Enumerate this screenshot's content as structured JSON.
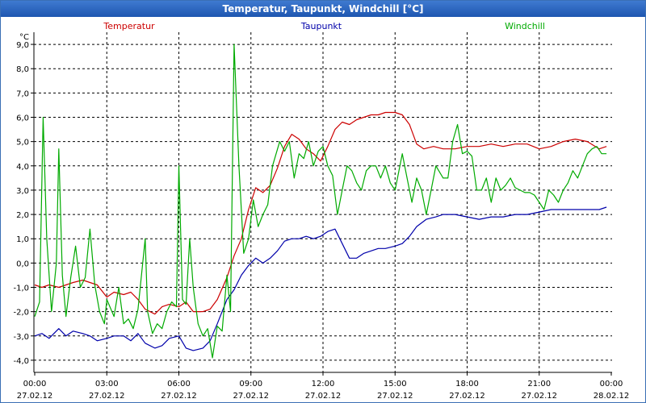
{
  "window": {
    "title": "Temperatur, Taupunkt, Windchill [°C]"
  },
  "chart_data": {
    "type": "line",
    "title": "Temperatur, Taupunkt, Windchill [°C]",
    "ylabel": "°C",
    "ylim": [
      -4.5,
      9.5
    ],
    "xlim": [
      0,
      24
    ],
    "grid": true,
    "legend_position": "top",
    "yticks": [
      "9,0",
      "8,0",
      "7,0",
      "6,0",
      "5,0",
      "4,0",
      "3,0",
      "2,0",
      "1,0",
      "0,0",
      "-1,0",
      "-2,0",
      "-3,0",
      "-4,0"
    ],
    "xticks": [
      {
        "time": "00:00",
        "date": "27.02.12"
      },
      {
        "time": "03:00",
        "date": "27.02.12"
      },
      {
        "time": "06:00",
        "date": "27.02.12"
      },
      {
        "time": "09:00",
        "date": "27.02.12"
      },
      {
        "time": "12:00",
        "date": "27.02.12"
      },
      {
        "time": "15:00",
        "date": "27.02.12"
      },
      {
        "time": "18:00",
        "date": "27.02.12"
      },
      {
        "time": "21:00",
        "date": "27.02.12"
      },
      {
        "time": "00:00",
        "date": "28.02.12"
      }
    ],
    "series": [
      {
        "name": "Temperatur",
        "color": "#cc0000",
        "points": [
          [
            0,
            -0.9
          ],
          [
            0.3,
            -1.0
          ],
          [
            0.6,
            -0.9
          ],
          [
            1.0,
            -1.0
          ],
          [
            1.3,
            -0.9
          ],
          [
            1.6,
            -0.8
          ],
          [
            2.0,
            -0.7
          ],
          [
            2.3,
            -0.8
          ],
          [
            2.6,
            -0.9
          ],
          [
            3.0,
            -1.4
          ],
          [
            3.3,
            -1.2
          ],
          [
            3.7,
            -1.3
          ],
          [
            4.0,
            -1.2
          ],
          [
            4.3,
            -1.5
          ],
          [
            4.6,
            -1.9
          ],
          [
            5.0,
            -2.1
          ],
          [
            5.3,
            -1.8
          ],
          [
            5.6,
            -1.7
          ],
          [
            6.0,
            -1.8
          ],
          [
            6.3,
            -1.6
          ],
          [
            6.6,
            -2.0
          ],
          [
            7.0,
            -2.0
          ],
          [
            7.3,
            -1.9
          ],
          [
            7.6,
            -1.5
          ],
          [
            8.0,
            -0.6
          ],
          [
            8.3,
            0.3
          ],
          [
            8.6,
            1.0
          ],
          [
            8.9,
            2.2
          ],
          [
            9.2,
            3.1
          ],
          [
            9.5,
            2.9
          ],
          [
            9.8,
            3.2
          ],
          [
            10.1,
            3.9
          ],
          [
            10.4,
            4.8
          ],
          [
            10.7,
            5.3
          ],
          [
            11.0,
            5.1
          ],
          [
            11.3,
            4.7
          ],
          [
            11.6,
            4.5
          ],
          [
            11.9,
            4.2
          ],
          [
            12.2,
            4.8
          ],
          [
            12.5,
            5.5
          ],
          [
            12.8,
            5.8
          ],
          [
            13.1,
            5.7
          ],
          [
            13.4,
            5.9
          ],
          [
            13.7,
            6.0
          ],
          [
            14.0,
            6.1
          ],
          [
            14.3,
            6.1
          ],
          [
            14.6,
            6.2
          ],
          [
            15.0,
            6.2
          ],
          [
            15.3,
            6.1
          ],
          [
            15.6,
            5.7
          ],
          [
            15.9,
            4.9
          ],
          [
            16.2,
            4.7
          ],
          [
            16.6,
            4.8
          ],
          [
            17.0,
            4.7
          ],
          [
            17.5,
            4.7
          ],
          [
            18.0,
            4.8
          ],
          [
            18.5,
            4.8
          ],
          [
            19.0,
            4.9
          ],
          [
            19.5,
            4.8
          ],
          [
            20.0,
            4.9
          ],
          [
            20.5,
            4.9
          ],
          [
            21.0,
            4.7
          ],
          [
            21.5,
            4.8
          ],
          [
            22.0,
            5.0
          ],
          [
            22.5,
            5.1
          ],
          [
            23.0,
            5.0
          ],
          [
            23.5,
            4.7
          ],
          [
            23.8,
            4.8
          ]
        ]
      },
      {
        "name": "Taupunkt",
        "color": "#0000aa",
        "points": [
          [
            0,
            -3.0
          ],
          [
            0.3,
            -2.9
          ],
          [
            0.6,
            -3.1
          ],
          [
            1.0,
            -2.7
          ],
          [
            1.3,
            -3.0
          ],
          [
            1.6,
            -2.8
          ],
          [
            2.0,
            -2.9
          ],
          [
            2.3,
            -3.0
          ],
          [
            2.6,
            -3.2
          ],
          [
            3.0,
            -3.1
          ],
          [
            3.3,
            -3.0
          ],
          [
            3.7,
            -3.0
          ],
          [
            4.0,
            -3.2
          ],
          [
            4.3,
            -2.9
          ],
          [
            4.6,
            -3.3
          ],
          [
            5.0,
            -3.5
          ],
          [
            5.3,
            -3.4
          ],
          [
            5.6,
            -3.1
          ],
          [
            6.0,
            -3.0
          ],
          [
            6.3,
            -3.5
          ],
          [
            6.6,
            -3.6
          ],
          [
            7.0,
            -3.5
          ],
          [
            7.3,
            -3.2
          ],
          [
            7.6,
            -2.5
          ],
          [
            8.0,
            -1.5
          ],
          [
            8.3,
            -1.1
          ],
          [
            8.6,
            -0.5
          ],
          [
            8.9,
            -0.1
          ],
          [
            9.2,
            0.2
          ],
          [
            9.5,
            0.0
          ],
          [
            9.8,
            0.2
          ],
          [
            10.1,
            0.5
          ],
          [
            10.4,
            0.9
          ],
          [
            10.7,
            1.0
          ],
          [
            11.0,
            1.0
          ],
          [
            11.3,
            1.1
          ],
          [
            11.6,
            1.0
          ],
          [
            11.9,
            1.1
          ],
          [
            12.2,
            1.3
          ],
          [
            12.5,
            1.4
          ],
          [
            12.8,
            0.8
          ],
          [
            13.1,
            0.2
          ],
          [
            13.4,
            0.2
          ],
          [
            13.7,
            0.4
          ],
          [
            14.0,
            0.5
          ],
          [
            14.3,
            0.6
          ],
          [
            14.6,
            0.6
          ],
          [
            15.0,
            0.7
          ],
          [
            15.3,
            0.8
          ],
          [
            15.6,
            1.1
          ],
          [
            15.9,
            1.5
          ],
          [
            16.3,
            1.8
          ],
          [
            16.7,
            1.9
          ],
          [
            17.0,
            2.0
          ],
          [
            17.5,
            2.0
          ],
          [
            18.0,
            1.9
          ],
          [
            18.5,
            1.8
          ],
          [
            19.0,
            1.9
          ],
          [
            19.5,
            1.9
          ],
          [
            20.0,
            2.0
          ],
          [
            20.5,
            2.0
          ],
          [
            21.0,
            2.1
          ],
          [
            21.5,
            2.2
          ],
          [
            22.0,
            2.2
          ],
          [
            22.5,
            2.2
          ],
          [
            23.0,
            2.2
          ],
          [
            23.5,
            2.2
          ],
          [
            23.8,
            2.3
          ]
        ]
      },
      {
        "name": "Windchill",
        "color": "#00aa00",
        "points": [
          [
            0,
            -2.2
          ],
          [
            0.2,
            -1.6
          ],
          [
            0.35,
            6.0
          ],
          [
            0.5,
            1.0
          ],
          [
            0.7,
            -2.0
          ],
          [
            0.9,
            0.0
          ],
          [
            1.0,
            4.7
          ],
          [
            1.15,
            -0.5
          ],
          [
            1.3,
            -2.2
          ],
          [
            1.5,
            -0.6
          ],
          [
            1.7,
            0.7
          ],
          [
            1.9,
            -1.0
          ],
          [
            2.1,
            -0.6
          ],
          [
            2.3,
            1.4
          ],
          [
            2.5,
            -0.9
          ],
          [
            2.7,
            -2.0
          ],
          [
            2.9,
            -2.5
          ],
          [
            3.0,
            -1.5
          ],
          [
            3.3,
            -2.2
          ],
          [
            3.5,
            -1.0
          ],
          [
            3.7,
            -2.5
          ],
          [
            3.9,
            -2.3
          ],
          [
            4.1,
            -2.7
          ],
          [
            4.3,
            -1.9
          ],
          [
            4.6,
            1.0
          ],
          [
            4.7,
            -2.0
          ],
          [
            4.9,
            -2.9
          ],
          [
            5.1,
            -2.5
          ],
          [
            5.3,
            -2.7
          ],
          [
            5.5,
            -2.0
          ],
          [
            5.7,
            -1.6
          ],
          [
            5.9,
            -1.8
          ],
          [
            6.0,
            4.0
          ],
          [
            6.15,
            -1.5
          ],
          [
            6.3,
            -1.7
          ],
          [
            6.45,
            1.0
          ],
          [
            6.6,
            -1.0
          ],
          [
            6.8,
            -2.5
          ],
          [
            7.0,
            -3.0
          ],
          [
            7.2,
            -2.7
          ],
          [
            7.4,
            -3.9
          ],
          [
            7.6,
            -2.6
          ],
          [
            7.8,
            -2.8
          ],
          [
            8.0,
            -0.5
          ],
          [
            8.15,
            -2.0
          ],
          [
            8.3,
            9.0
          ],
          [
            8.5,
            4.0
          ],
          [
            8.7,
            0.4
          ],
          [
            8.9,
            1.0
          ],
          [
            9.1,
            2.6
          ],
          [
            9.3,
            1.5
          ],
          [
            9.5,
            2.0
          ],
          [
            9.7,
            2.4
          ],
          [
            9.9,
            4.0
          ],
          [
            10.2,
            5.0
          ],
          [
            10.4,
            4.6
          ],
          [
            10.6,
            5.0
          ],
          [
            10.8,
            3.5
          ],
          [
            11.0,
            4.5
          ],
          [
            11.2,
            4.3
          ],
          [
            11.4,
            5.0
          ],
          [
            11.6,
            4.0
          ],
          [
            11.8,
            4.6
          ],
          [
            12.0,
            4.8
          ],
          [
            12.2,
            4.0
          ],
          [
            12.4,
            3.6
          ],
          [
            12.6,
            2.0
          ],
          [
            12.8,
            3.0
          ],
          [
            13.0,
            4.0
          ],
          [
            13.2,
            3.8
          ],
          [
            13.4,
            3.3
          ],
          [
            13.6,
            3.0
          ],
          [
            13.8,
            3.8
          ],
          [
            14.0,
            4.0
          ],
          [
            14.2,
            4.0
          ],
          [
            14.4,
            3.5
          ],
          [
            14.6,
            4.0
          ],
          [
            14.8,
            3.3
          ],
          [
            15.0,
            3.0
          ],
          [
            15.3,
            4.5
          ],
          [
            15.5,
            3.5
          ],
          [
            15.7,
            2.5
          ],
          [
            15.9,
            3.5
          ],
          [
            16.1,
            3.0
          ],
          [
            16.3,
            2.0
          ],
          [
            16.5,
            3.0
          ],
          [
            16.7,
            4.0
          ],
          [
            17.0,
            3.5
          ],
          [
            17.2,
            3.5
          ],
          [
            17.4,
            5.0
          ],
          [
            17.6,
            5.7
          ],
          [
            17.8,
            4.5
          ],
          [
            18.0,
            4.6
          ],
          [
            18.2,
            4.4
          ],
          [
            18.4,
            3.0
          ],
          [
            18.6,
            3.0
          ],
          [
            18.8,
            3.5
          ],
          [
            19.0,
            2.5
          ],
          [
            19.2,
            3.5
          ],
          [
            19.4,
            3.0
          ],
          [
            19.6,
            3.2
          ],
          [
            19.8,
            3.5
          ],
          [
            20.0,
            3.1
          ],
          [
            20.2,
            3.0
          ],
          [
            20.4,
            2.9
          ],
          [
            20.6,
            2.9
          ],
          [
            20.8,
            2.8
          ],
          [
            21.0,
            2.5
          ],
          [
            21.2,
            2.2
          ],
          [
            21.4,
            3.0
          ],
          [
            21.6,
            2.8
          ],
          [
            21.8,
            2.5
          ],
          [
            22.0,
            3.0
          ],
          [
            22.2,
            3.3
          ],
          [
            22.4,
            3.8
          ],
          [
            22.6,
            3.5
          ],
          [
            22.8,
            4.0
          ],
          [
            23.0,
            4.5
          ],
          [
            23.2,
            4.7
          ],
          [
            23.4,
            4.8
          ],
          [
            23.6,
            4.5
          ],
          [
            23.8,
            4.5
          ]
        ]
      }
    ]
  }
}
